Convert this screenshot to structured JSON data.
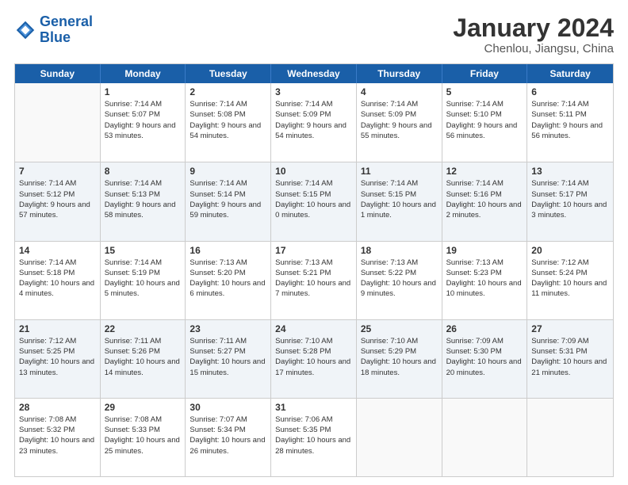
{
  "header": {
    "logo_general": "General",
    "logo_blue": "Blue",
    "month_title": "January 2024",
    "subtitle": "Chenlou, Jiangsu, China"
  },
  "weekdays": [
    "Sunday",
    "Monday",
    "Tuesday",
    "Wednesday",
    "Thursday",
    "Friday",
    "Saturday"
  ],
  "weeks": [
    [
      {
        "day": "",
        "sunrise": "",
        "sunset": "",
        "daylight": "",
        "empty": true
      },
      {
        "day": "1",
        "sunrise": "Sunrise: 7:14 AM",
        "sunset": "Sunset: 5:07 PM",
        "daylight": "Daylight: 9 hours and 53 minutes."
      },
      {
        "day": "2",
        "sunrise": "Sunrise: 7:14 AM",
        "sunset": "Sunset: 5:08 PM",
        "daylight": "Daylight: 9 hours and 54 minutes."
      },
      {
        "day": "3",
        "sunrise": "Sunrise: 7:14 AM",
        "sunset": "Sunset: 5:09 PM",
        "daylight": "Daylight: 9 hours and 54 minutes."
      },
      {
        "day": "4",
        "sunrise": "Sunrise: 7:14 AM",
        "sunset": "Sunset: 5:09 PM",
        "daylight": "Daylight: 9 hours and 55 minutes."
      },
      {
        "day": "5",
        "sunrise": "Sunrise: 7:14 AM",
        "sunset": "Sunset: 5:10 PM",
        "daylight": "Daylight: 9 hours and 56 minutes."
      },
      {
        "day": "6",
        "sunrise": "Sunrise: 7:14 AM",
        "sunset": "Sunset: 5:11 PM",
        "daylight": "Daylight: 9 hours and 56 minutes."
      }
    ],
    [
      {
        "day": "7",
        "sunrise": "Sunrise: 7:14 AM",
        "sunset": "Sunset: 5:12 PM",
        "daylight": "Daylight: 9 hours and 57 minutes."
      },
      {
        "day": "8",
        "sunrise": "Sunrise: 7:14 AM",
        "sunset": "Sunset: 5:13 PM",
        "daylight": "Daylight: 9 hours and 58 minutes."
      },
      {
        "day": "9",
        "sunrise": "Sunrise: 7:14 AM",
        "sunset": "Sunset: 5:14 PM",
        "daylight": "Daylight: 9 hours and 59 minutes."
      },
      {
        "day": "10",
        "sunrise": "Sunrise: 7:14 AM",
        "sunset": "Sunset: 5:15 PM",
        "daylight": "Daylight: 10 hours and 0 minutes."
      },
      {
        "day": "11",
        "sunrise": "Sunrise: 7:14 AM",
        "sunset": "Sunset: 5:15 PM",
        "daylight": "Daylight: 10 hours and 1 minute."
      },
      {
        "day": "12",
        "sunrise": "Sunrise: 7:14 AM",
        "sunset": "Sunset: 5:16 PM",
        "daylight": "Daylight: 10 hours and 2 minutes."
      },
      {
        "day": "13",
        "sunrise": "Sunrise: 7:14 AM",
        "sunset": "Sunset: 5:17 PM",
        "daylight": "Daylight: 10 hours and 3 minutes."
      }
    ],
    [
      {
        "day": "14",
        "sunrise": "Sunrise: 7:14 AM",
        "sunset": "Sunset: 5:18 PM",
        "daylight": "Daylight: 10 hours and 4 minutes."
      },
      {
        "day": "15",
        "sunrise": "Sunrise: 7:14 AM",
        "sunset": "Sunset: 5:19 PM",
        "daylight": "Daylight: 10 hours and 5 minutes."
      },
      {
        "day": "16",
        "sunrise": "Sunrise: 7:13 AM",
        "sunset": "Sunset: 5:20 PM",
        "daylight": "Daylight: 10 hours and 6 minutes."
      },
      {
        "day": "17",
        "sunrise": "Sunrise: 7:13 AM",
        "sunset": "Sunset: 5:21 PM",
        "daylight": "Daylight: 10 hours and 7 minutes."
      },
      {
        "day": "18",
        "sunrise": "Sunrise: 7:13 AM",
        "sunset": "Sunset: 5:22 PM",
        "daylight": "Daylight: 10 hours and 9 minutes."
      },
      {
        "day": "19",
        "sunrise": "Sunrise: 7:13 AM",
        "sunset": "Sunset: 5:23 PM",
        "daylight": "Daylight: 10 hours and 10 minutes."
      },
      {
        "day": "20",
        "sunrise": "Sunrise: 7:12 AM",
        "sunset": "Sunset: 5:24 PM",
        "daylight": "Daylight: 10 hours and 11 minutes."
      }
    ],
    [
      {
        "day": "21",
        "sunrise": "Sunrise: 7:12 AM",
        "sunset": "Sunset: 5:25 PM",
        "daylight": "Daylight: 10 hours and 13 minutes."
      },
      {
        "day": "22",
        "sunrise": "Sunrise: 7:11 AM",
        "sunset": "Sunset: 5:26 PM",
        "daylight": "Daylight: 10 hours and 14 minutes."
      },
      {
        "day": "23",
        "sunrise": "Sunrise: 7:11 AM",
        "sunset": "Sunset: 5:27 PM",
        "daylight": "Daylight: 10 hours and 15 minutes."
      },
      {
        "day": "24",
        "sunrise": "Sunrise: 7:10 AM",
        "sunset": "Sunset: 5:28 PM",
        "daylight": "Daylight: 10 hours and 17 minutes."
      },
      {
        "day": "25",
        "sunrise": "Sunrise: 7:10 AM",
        "sunset": "Sunset: 5:29 PM",
        "daylight": "Daylight: 10 hours and 18 minutes."
      },
      {
        "day": "26",
        "sunrise": "Sunrise: 7:09 AM",
        "sunset": "Sunset: 5:30 PM",
        "daylight": "Daylight: 10 hours and 20 minutes."
      },
      {
        "day": "27",
        "sunrise": "Sunrise: 7:09 AM",
        "sunset": "Sunset: 5:31 PM",
        "daylight": "Daylight: 10 hours and 21 minutes."
      }
    ],
    [
      {
        "day": "28",
        "sunrise": "Sunrise: 7:08 AM",
        "sunset": "Sunset: 5:32 PM",
        "daylight": "Daylight: 10 hours and 23 minutes."
      },
      {
        "day": "29",
        "sunrise": "Sunrise: 7:08 AM",
        "sunset": "Sunset: 5:33 PM",
        "daylight": "Daylight: 10 hours and 25 minutes."
      },
      {
        "day": "30",
        "sunrise": "Sunrise: 7:07 AM",
        "sunset": "Sunset: 5:34 PM",
        "daylight": "Daylight: 10 hours and 26 minutes."
      },
      {
        "day": "31",
        "sunrise": "Sunrise: 7:06 AM",
        "sunset": "Sunset: 5:35 PM",
        "daylight": "Daylight: 10 hours and 28 minutes."
      },
      {
        "day": "",
        "sunrise": "",
        "sunset": "",
        "daylight": "",
        "empty": true
      },
      {
        "day": "",
        "sunrise": "",
        "sunset": "",
        "daylight": "",
        "empty": true
      },
      {
        "day": "",
        "sunrise": "",
        "sunset": "",
        "daylight": "",
        "empty": true
      }
    ]
  ]
}
